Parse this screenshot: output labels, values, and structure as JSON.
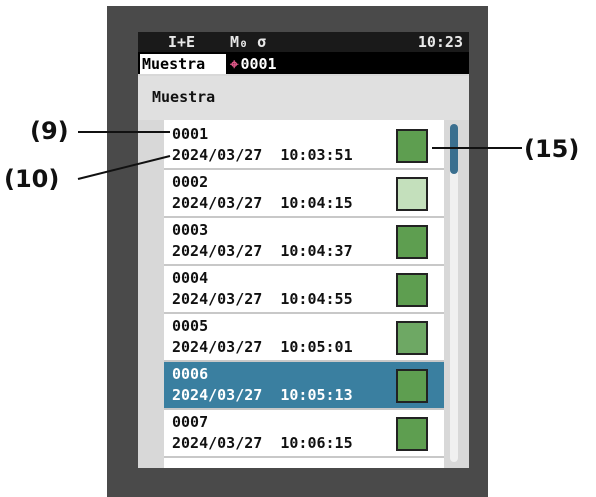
{
  "status": {
    "mode": "I+E",
    "memo": "M₀ σ",
    "time": "10:23"
  },
  "tabs": {
    "active": "Muestra",
    "sample_icon": "target-icon",
    "sample_number": "0001"
  },
  "header_title": "Muestra",
  "rows": [
    {
      "name": "0001",
      "date": "2024/03/27  10:03:51",
      "color": "#5e9e50"
    },
    {
      "name": "0002",
      "date": "2024/03/27  10:04:15",
      "color": "#c4e0bc"
    },
    {
      "name": "0003",
      "date": "2024/03/27  10:04:37",
      "color": "#5e9e50"
    },
    {
      "name": "0004",
      "date": "2024/03/27  10:04:55",
      "color": "#5e9e50"
    },
    {
      "name": "0005",
      "date": "2024/03/27  10:05:01",
      "color": "#6ea864"
    },
    {
      "name": "0006",
      "date": "2024/03/27  10:05:13",
      "color": "#5e9e50",
      "selected": true
    },
    {
      "name": "0007",
      "date": "2024/03/27  10:06:15",
      "color": "#5e9e50"
    }
  ],
  "callouts": {
    "c9": "(9)",
    "c10": "(10)",
    "c15": "(15)"
  },
  "colors": {
    "selected": "#3a7fa0",
    "scroll_thumb": "#3a6f8f"
  }
}
